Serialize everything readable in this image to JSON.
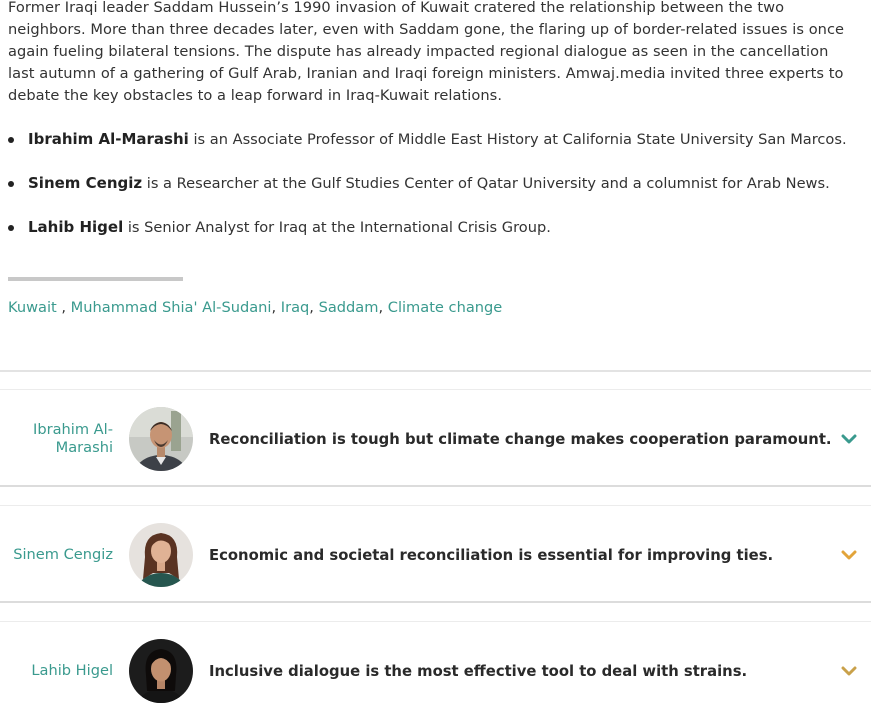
{
  "intro": {
    "text": "Former Iraqi leader Saddam Hussein’s 1990 invasion of Kuwait cratered the relationship between the two neighbors. More than three decades later, even with Saddam gone, the flaring up of border-related issues is once again fueling bilateral tensions. The dispute has already impacted regional dialogue as seen in the cancellation last autumn of a gathering of Gulf Arab, Iranian and Iraqi foreign ministers. Amwaj.media invited three experts to debate the key obstacles to a leap forward in Iraq-Kuwait relations."
  },
  "experts": [
    {
      "name": "Ibrahim Al-Marashi",
      "desc": " is an Associate Professor of Middle East History at California State University San Marcos."
    },
    {
      "name": "Sinem Cengiz",
      "desc": " is a Researcher at the Gulf Studies Center of Qatar University and a columnist for Arab News."
    },
    {
      "name": "Lahib Higel",
      "desc": " is Senior Analyst for Iraq at the International Crisis Group."
    }
  ],
  "tags": {
    "items": [
      "Kuwait",
      "Muhammad Shia' Al-Sudani",
      "Iraq",
      "Saddam",
      "Climate change"
    ],
    "sep_first": " , ",
    "sep": ", "
  },
  "cards": [
    {
      "name": "Ibrahim Al-\nMarashi",
      "quote": "Reconciliation is tough but climate change makes cooperation paramount.",
      "chevron_color": "#3a9a8e"
    },
    {
      "name": "Sinem Cengiz",
      "quote": "Economic and societal reconciliation is essential for improving ties.",
      "chevron_color": "#e2a43a"
    },
    {
      "name": "Lahib Higel",
      "quote": "Inclusive dialogue is the most effective tool to deal with strains.",
      "chevron_color": "#c9a14a"
    }
  ],
  "colors": {
    "accent": "#3a9a8e",
    "text": "#333333"
  }
}
